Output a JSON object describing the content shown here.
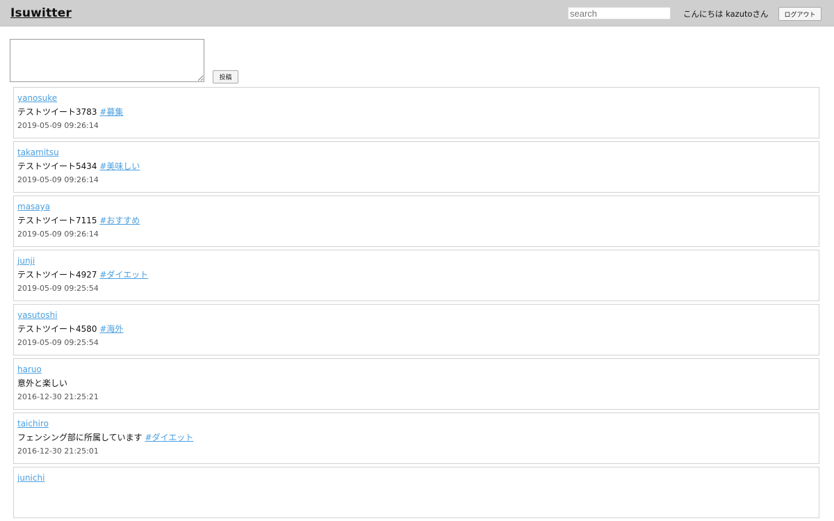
{
  "header": {
    "title": "Isuwitter",
    "search_placeholder": "search",
    "greeting": "こんにちは kazutoさん",
    "logout_label": "ログアウト"
  },
  "compose": {
    "value": "",
    "post_label": "投稿"
  },
  "tweets": [
    {
      "user": "yanosuke",
      "text": "テストツイート3783",
      "hashtag": "#募集",
      "time": "2019-05-09 09:26:14"
    },
    {
      "user": "takamitsu",
      "text": "テストツイート5434",
      "hashtag": "#美味しい",
      "time": "2019-05-09 09:26:14"
    },
    {
      "user": "masaya",
      "text": "テストツイート7115",
      "hashtag": "#おすすめ",
      "time": "2019-05-09 09:26:14"
    },
    {
      "user": "junji",
      "text": "テストツイート4927",
      "hashtag": "#ダイエット",
      "time": "2019-05-09 09:25:54"
    },
    {
      "user": "yasutoshi",
      "text": "テストツイート4580",
      "hashtag": "#海外",
      "time": "2019-05-09 09:25:54"
    },
    {
      "user": "haruo",
      "text": "意外と楽しい",
      "hashtag": "",
      "time": "2016-12-30 21:25:21"
    },
    {
      "user": "taichiro",
      "text": "フェンシング部に所属しています",
      "hashtag": "#ダイエット",
      "time": "2016-12-30 21:25:01"
    },
    {
      "user": "junichi",
      "text": "",
      "hashtag": "",
      "time": ""
    }
  ]
}
